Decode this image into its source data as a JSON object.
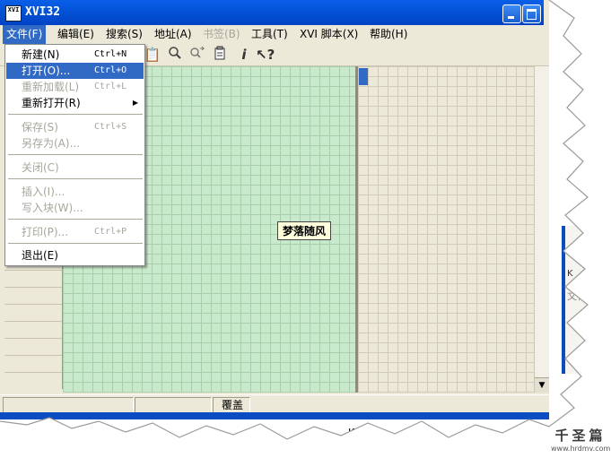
{
  "window": {
    "title": "XVI32",
    "icon_text": "XVI"
  },
  "menubar": {
    "items": [
      {
        "label": "文件(F)",
        "active": true,
        "disabled": false
      },
      {
        "label": "编辑(E)",
        "active": false,
        "disabled": false
      },
      {
        "label": "搜索(S)",
        "active": false,
        "disabled": false
      },
      {
        "label": "地址(A)",
        "active": false,
        "disabled": false
      },
      {
        "label": "书签(B)",
        "active": false,
        "disabled": true
      },
      {
        "label": "工具(T)",
        "active": false,
        "disabled": false
      },
      {
        "label": "XVI 脚本(X)",
        "active": false,
        "disabled": false
      },
      {
        "label": "帮助(H)",
        "active": false,
        "disabled": false
      }
    ]
  },
  "toolbar": {
    "icons": [
      "paste-icon",
      "search-icon",
      "replace-icon",
      "clipboard-icon",
      "info-icon",
      "help-pointer-icon"
    ]
  },
  "file_menu": {
    "items": [
      {
        "label": "新建(N)",
        "shortcut": "Ctrl+N",
        "state": "enabled"
      },
      {
        "label": "打开(O)...",
        "shortcut": "Ctrl+O",
        "state": "selected"
      },
      {
        "label": "重新加载(L)",
        "shortcut": "Ctrl+L",
        "state": "disabled"
      },
      {
        "label": "重新打开(R)",
        "shortcut": "",
        "state": "enabled",
        "submenu": true
      },
      {
        "label": "保存(S)",
        "shortcut": "Ctrl+S",
        "state": "disabled"
      },
      {
        "label": "另存为(A)...",
        "shortcut": "",
        "state": "disabled"
      },
      {
        "label": "关闭(C)",
        "shortcut": "",
        "state": "disabled"
      },
      {
        "label": "插入(I)...",
        "shortcut": "",
        "state": "disabled"
      },
      {
        "label": "写入块(W)...",
        "shortcut": "",
        "state": "disabled"
      },
      {
        "label": "打印(P)...",
        "shortcut": "Ctrl+P",
        "state": "disabled"
      },
      {
        "label": "退出(E)",
        "shortcut": "",
        "state": "enabled"
      }
    ]
  },
  "editor": {
    "overlay_label": "梦落随风"
  },
  "statusbar": {
    "mode": "覆盖"
  },
  "footer": {
    "size_unit": "KB"
  },
  "side_window": {
    "text_1": "K",
    "text_2": "文化"
  },
  "brand": {
    "name": "千圣篇",
    "url": "www.hrdmv.com"
  },
  "colors": {
    "titlebar": "#0454d8",
    "selection": "#316ac5",
    "hex_pane": "#c9e9cc",
    "face": "#ece9d8"
  }
}
